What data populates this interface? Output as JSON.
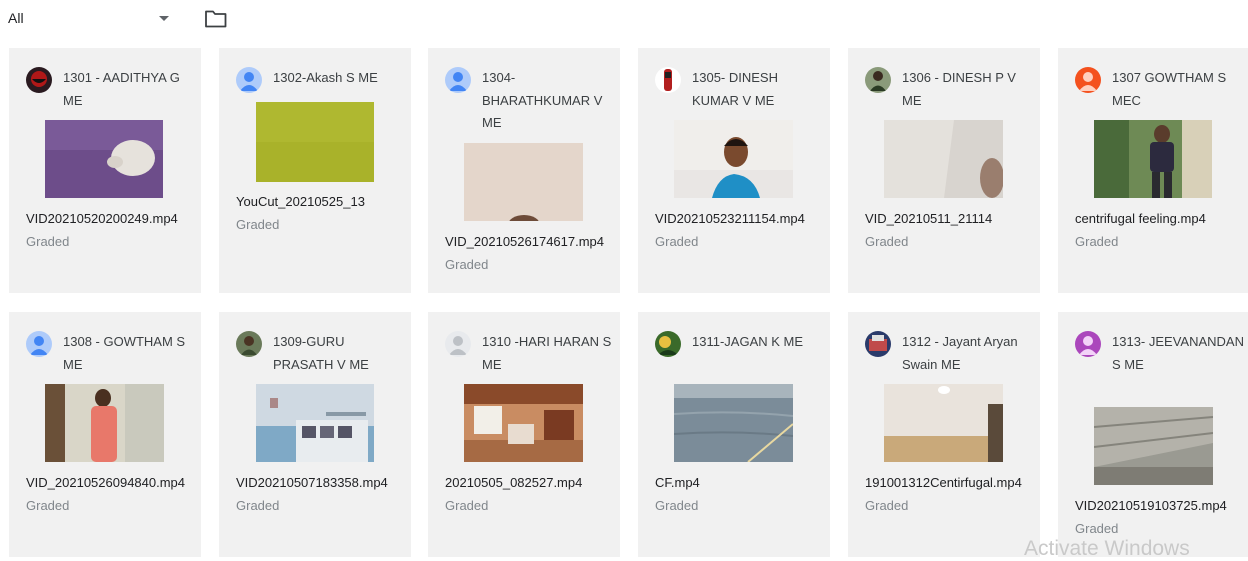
{
  "toolbar": {
    "filter_value": "All"
  },
  "icons": {
    "filter_dropdown": "chevron-down-icon",
    "folder": "folder-icon"
  },
  "cards": [
    {
      "name": "1301 - AADITHYA G ME",
      "file": "VID20210520200249.mp4",
      "status": "Graded",
      "avatar": "photo-avatar"
    },
    {
      "name": "1302-Akash S ME",
      "file": "YouCut_20210525_13",
      "status": "Graded",
      "avatar": "default-avatar"
    },
    {
      "name": "1304-BHARATHKUMAR V ME",
      "file": "VID_20210526174617.mp4",
      "status": "Graded",
      "avatar": "default-avatar"
    },
    {
      "name": "1305- DINESH KUMAR V ME",
      "file": "VID20210523211154.mp4",
      "status": "Graded",
      "avatar": "photo-avatar"
    },
    {
      "name": "1306 - DINESH P V ME",
      "file": "VID_20210511_21114",
      "status": "Graded",
      "avatar": "photo-avatar"
    },
    {
      "name": "1307 GOWTHAM S MEC",
      "file": "centrifugal feeling.mp4",
      "status": "Graded",
      "avatar": "initial-avatar"
    },
    {
      "name": "1308 - GOWTHAM S ME",
      "file": "VID_20210526094840.mp4",
      "status": "Graded",
      "avatar": "default-avatar"
    },
    {
      "name": "1309-GURU PRASATH V ME",
      "file": "VID20210507183358.mp4",
      "status": "Graded",
      "avatar": "photo-avatar"
    },
    {
      "name": "1310 -HARI HARAN S ME",
      "file": "20210505_082527.mp4",
      "status": "Graded",
      "avatar": "default-avatar-light"
    },
    {
      "name": "1311-JAGAN K ME",
      "file": "CF.mp4",
      "status": "Graded",
      "avatar": "photo-avatar"
    },
    {
      "name": "1312 - Jayant Aryan Swain ME",
      "file": "191001312Centirfugal.mp4",
      "status": "Graded",
      "avatar": "photo-avatar"
    },
    {
      "name": "1313- JEEVANANDAN S ME",
      "file": "VID20210519103725.mp4",
      "status": "Graded",
      "avatar": "initial-avatar"
    }
  ],
  "watermark": "Activate Windows"
}
